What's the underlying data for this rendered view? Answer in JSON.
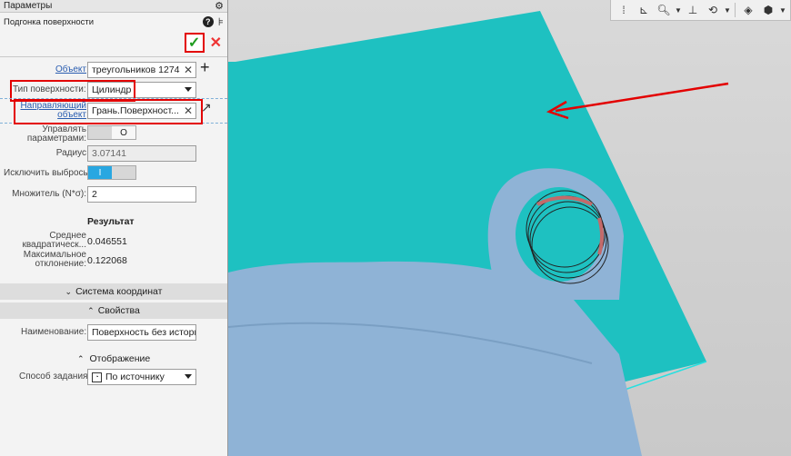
{
  "panel": {
    "header_title": "Параметры",
    "operation_title": "Подгонка поверхности"
  },
  "fields": {
    "object_label": "Объект",
    "object_value": "треугольников 1274",
    "surface_type_label": "Тип поверхности:",
    "surface_type_value": "Цилиндр",
    "guide_label_line1": "Направляющий",
    "guide_label_line2": "объект",
    "guide_value": "Грань.Поверхност...",
    "control_params_line1": "Управлять",
    "control_params_line2": "параметрами:",
    "control_params_state": "O",
    "radius_label": "Радиус",
    "radius_value": "3.07141",
    "exclude_outliers_label": "Исключить выбросы:",
    "exclude_outliers_state": "I",
    "multiplier_label": "Множитель (N*σ):",
    "multiplier_value": "2"
  },
  "result": {
    "title": "Результат",
    "rms_label_line1": "Среднее",
    "rms_label_line2": "квадратическ...",
    "rms_value": "0.046551",
    "max_dev_label_line1": "Максимальное",
    "max_dev_label_line2": "отклонение:",
    "max_dev_value": "0.122068"
  },
  "sections": {
    "coord_system": "Система координат",
    "properties": "Свойства",
    "display": "Отображение"
  },
  "properties": {
    "name_label": "Наименование:",
    "name_value": "Поверхность без истории",
    "method_label": "Способ задания:",
    "method_value": "По источнику"
  },
  "colors": {
    "accent_red": "#e30000",
    "surface_teal": "#1ec1c1",
    "model_blue": "#8fb3d6",
    "ok_green": "#1e9b1e"
  },
  "toolbar_icons": [
    "grip-icon",
    "view-orient-icon",
    "zoom-icon",
    "chevron-down-icon",
    "axes-icon",
    "rotate-icon",
    "chevron-down-icon",
    "render-cube-icon",
    "shading-icon",
    "chevron-down-icon"
  ]
}
